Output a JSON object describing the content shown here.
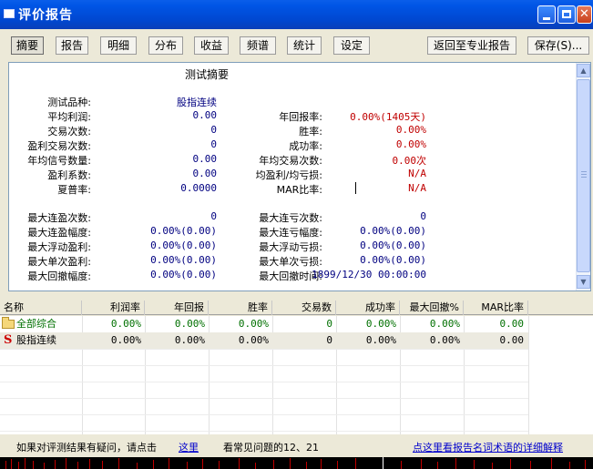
{
  "window": {
    "title": "评价报告"
  },
  "tabs": [
    "摘要",
    "报告",
    "明细",
    "分布",
    "收益",
    "频谱",
    "统计",
    "设定"
  ],
  "buttons": {
    "return": "返回至专业报告",
    "save": "保存(S)..."
  },
  "summary": {
    "title": "测试摘要",
    "product_label": "测试品种:",
    "product_value": "股指连续",
    "left": [
      {
        "label": "平均利润:",
        "value": "0.00"
      },
      {
        "label": "交易次数:",
        "value": "0"
      },
      {
        "label": "盈利交易次数:",
        "value": "0"
      },
      {
        "label": "年均信号数量:",
        "value": "0.00"
      },
      {
        "label": "盈利系数:",
        "value": "0.00"
      },
      {
        "label": "夏普率:",
        "value": "0.0000"
      }
    ],
    "right": [
      {
        "label": "年回报率:",
        "value": "0.00%(1405天)"
      },
      {
        "label": "胜率:",
        "value": "0.00%"
      },
      {
        "label": "成功率:",
        "value": "0.00%"
      },
      {
        "label": "年均交易次数:",
        "value": "0.00次"
      },
      {
        "label": "均盈利/均亏损:",
        "value": "N/A"
      },
      {
        "label": "MAR比率:",
        "value": "N/A"
      }
    ],
    "left2": [
      {
        "label": "最大连盈次数:",
        "value": "0"
      },
      {
        "label": "最大连盈幅度:",
        "value": "0.00%(0.00)"
      },
      {
        "label": "最大浮动盈利:",
        "value": "0.00%(0.00)"
      },
      {
        "label": "最大单次盈利:",
        "value": "0.00%(0.00)"
      },
      {
        "label": "最大回撤幅度:",
        "value": "0.00%(0.00)"
      }
    ],
    "right2": [
      {
        "label": "最大连亏次数:",
        "value": "0"
      },
      {
        "label": "最大连亏幅度:",
        "value": "0.00%(0.00)"
      },
      {
        "label": "最大浮动亏损:",
        "value": "0.00%(0.00)"
      },
      {
        "label": "最大单次亏损:",
        "value": "0.00%(0.00)"
      },
      {
        "label": "最大回撤时间:",
        "value": "1899/12/30 00:00:00"
      }
    ]
  },
  "table": {
    "columns": [
      "名称",
      "利润率",
      "年回报",
      "胜率",
      "交易数",
      "成功率",
      "最大回撤%",
      "MAR比率"
    ],
    "rows": [
      {
        "icon": "folder-icon",
        "cells": [
          "全部综合",
          "0.00%",
          "0.00%",
          "0.00%",
          "0",
          "0.00%",
          "0.00%",
          "0.00"
        ]
      },
      {
        "icon": "s-icon",
        "icon_text": "S",
        "cells": [
          "股指连续",
          "0.00%",
          "0.00%",
          "0.00%",
          "0",
          "0.00%",
          "0.00%",
          "0.00"
        ]
      }
    ]
  },
  "footer": {
    "prefix": "如果对评测结果有疑问，请点击",
    "link": "这里",
    "suffix": "看常见问题的12、21",
    "right_link": "点这里看报告名词术语的详细解释"
  },
  "colors": {
    "titlebar": "#0055E5",
    "value_blue": "#000080",
    "value_red": "#C00000",
    "cell_green": "#007000",
    "link": "#0000CC"
  }
}
